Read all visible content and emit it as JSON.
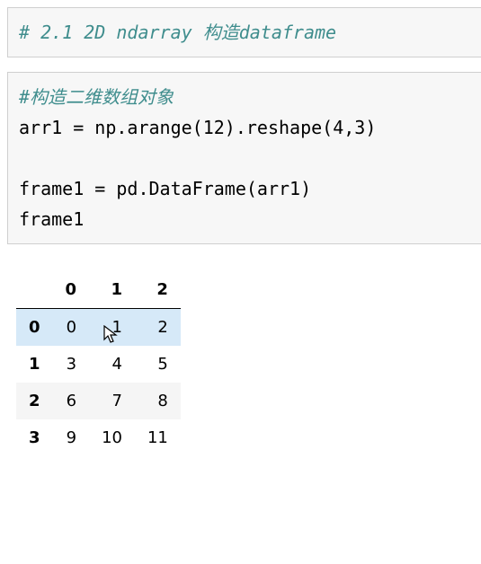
{
  "cell1": {
    "comment": "# 2.1 2D ndarray 构造dataframe"
  },
  "cell2": {
    "comment": "#构造二维数组对象",
    "line2": "arr1 = np.arange(12).reshape(4,3)",
    "line3": "",
    "line4": "frame1 = pd.DataFrame(arr1)",
    "line5": "frame1"
  },
  "df": {
    "columns": [
      "0",
      "1",
      "2"
    ],
    "index": [
      "0",
      "1",
      "2",
      "3"
    ],
    "rows": [
      [
        "0",
        "1",
        "2"
      ],
      [
        "3",
        "4",
        "5"
      ],
      [
        "6",
        "7",
        "8"
      ],
      [
        "9",
        "10",
        "11"
      ]
    ]
  },
  "chart_data": {
    "type": "table",
    "columns": [
      0,
      1,
      2
    ],
    "index": [
      0,
      1,
      2,
      3
    ],
    "data": [
      [
        0,
        1,
        2
      ],
      [
        3,
        4,
        5
      ],
      [
        6,
        7,
        8
      ],
      [
        9,
        10,
        11
      ]
    ]
  }
}
